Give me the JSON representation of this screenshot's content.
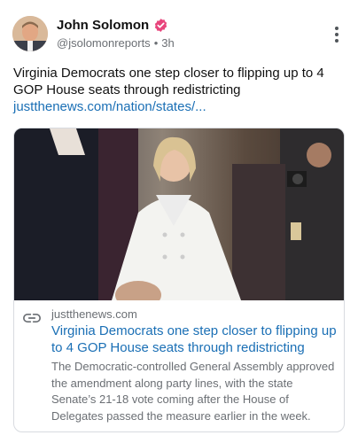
{
  "post": {
    "author": {
      "display_name": "John Solomon",
      "handle": "@jsolomonreports",
      "timestamp": "3h",
      "verified_color": "#e8457c"
    },
    "text": "Virginia Democrats one step closer to flipping up to 4 GOP House seats through redistricting",
    "link_text": "justthenews.com/nation/states/...",
    "more_icon": "more-vertical-icon"
  },
  "card": {
    "image_description_icon": "photo",
    "domain": "justthenews.com",
    "title": "Virginia Democrats one step closer to flipping up to 4 GOP House seats through redistricting",
    "description": "The Democratic-controlled General Assembly approved the amendment along party lines, with the state Senate’s 21-18 vote coming after the House of Delegates passed the measure earlier in the week.",
    "link_icon": "link-icon"
  },
  "colors": {
    "link": "#1a6fb5",
    "secondary_text": "#6b6f74",
    "border": "#d8dbe0"
  }
}
